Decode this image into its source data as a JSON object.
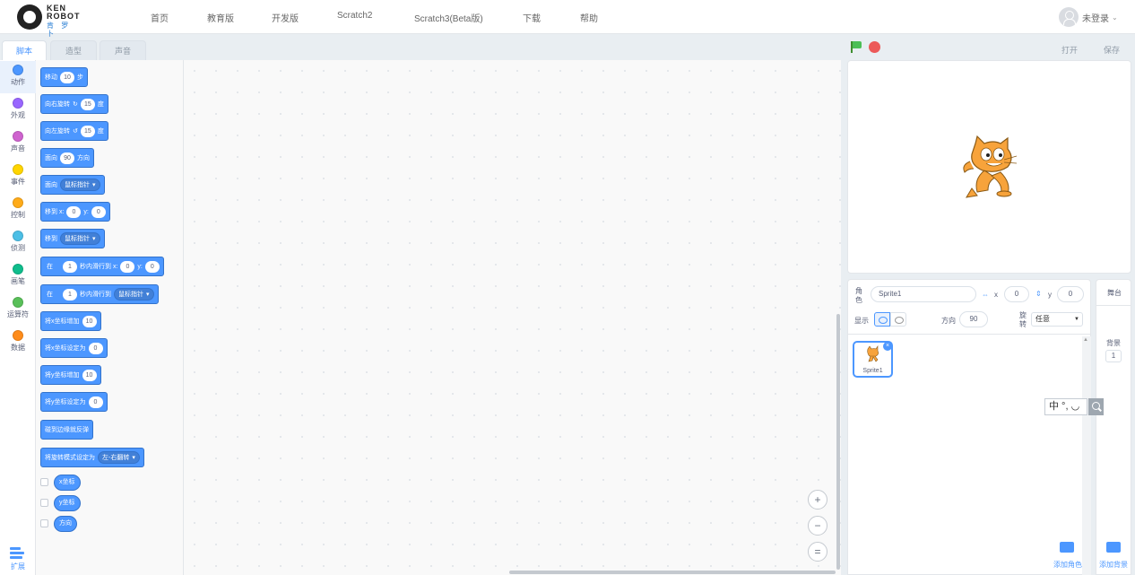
{
  "logo": {
    "line1": "KEN",
    "line2": "ROBOT",
    "line3": "肯 罗 卜"
  },
  "nav": [
    "首页",
    "教育版",
    "开发版",
    "Scratch2",
    "Scratch3(Beta版)",
    "下载",
    "帮助"
  ],
  "user": {
    "label": "未登录",
    "caret": "⌄"
  },
  "tabs": [
    "脚本",
    "造型",
    "声音"
  ],
  "categories": [
    {
      "label": "动作",
      "color": "#4c97ff"
    },
    {
      "label": "外观",
      "color": "#9966ff"
    },
    {
      "label": "声音",
      "color": "#cf63cf"
    },
    {
      "label": "事件",
      "color": "#ffd500"
    },
    {
      "label": "控制",
      "color": "#ffab19"
    },
    {
      "label": "侦测",
      "color": "#4cbfe6"
    },
    {
      "label": "画笔",
      "color": "#0fbd8c"
    },
    {
      "label": "运算符",
      "color": "#59c059"
    },
    {
      "label": "数据",
      "color": "#ff8c1a"
    }
  ],
  "extension_label": "扩展",
  "blocks": {
    "move": {
      "a": "移动",
      "v": "10",
      "b": "步"
    },
    "turn_right": {
      "a": "向右旋转",
      "icon": "↻",
      "v": "15",
      "b": "度"
    },
    "turn_left": {
      "a": "向左旋转",
      "icon": "↺",
      "v": "15",
      "b": "度"
    },
    "point_dir": {
      "a": "面向",
      "v": "90",
      "b": "方向"
    },
    "point_towards": {
      "a": "面向",
      "dd": "鼠标指针"
    },
    "goto_xy": {
      "a": "移到 x:",
      "x": "0",
      "b": "y:",
      "y": "0"
    },
    "goto": {
      "a": "移到",
      "dd": "鼠标指针"
    },
    "glide_xy": {
      "a": "在",
      "secs": "1",
      "b": "秒内滑行到 x:",
      "x": "0",
      "c": "y:",
      "y": "0"
    },
    "glide_to": {
      "a": "在",
      "secs": "1",
      "b": "秒内滑行到",
      "dd": "鼠标指针"
    },
    "change_x": {
      "a": "将x坐标增加",
      "v": "10"
    },
    "set_x": {
      "a": "将x坐标设定为",
      "v": "0"
    },
    "change_y": {
      "a": "将y坐标增加",
      "v": "10"
    },
    "set_y": {
      "a": "将y坐标设定为",
      "v": "0"
    },
    "bounce": {
      "a": "碰到边缘就反弹"
    },
    "rotation_style": {
      "a": "将旋转模式设定为",
      "dd": "左-右翻转"
    },
    "reporters": [
      "x坐标",
      "y坐标",
      "方向"
    ]
  },
  "dropdown_caret": "▾",
  "zoom": {
    "in": "+",
    "out": "−",
    "reset": "="
  },
  "stage_header": {
    "open": "打开",
    "save": "保存"
  },
  "sprite_info": {
    "sprite_label": "角色",
    "name": "Sprite1",
    "x_label": "x",
    "x": "0",
    "y_label": "y",
    "y": "0",
    "show_label": "显示",
    "direction_label": "方向",
    "direction": "90",
    "rotate_label": "旋转",
    "rotate_value": "任意"
  },
  "sprite_list": [
    {
      "name": "Sprite1"
    }
  ],
  "add_sprite": "添加角色",
  "stage_panel": {
    "title": "舞台",
    "backdrops_label": "背景",
    "backdrops_count": "1",
    "add_backdrop": "添加背景"
  },
  "ime": {
    "text": "中 °, ◡"
  },
  "colors": {
    "accent": "#4c97ff",
    "flag": "#4cbf56",
    "stop": "#ec5959"
  }
}
